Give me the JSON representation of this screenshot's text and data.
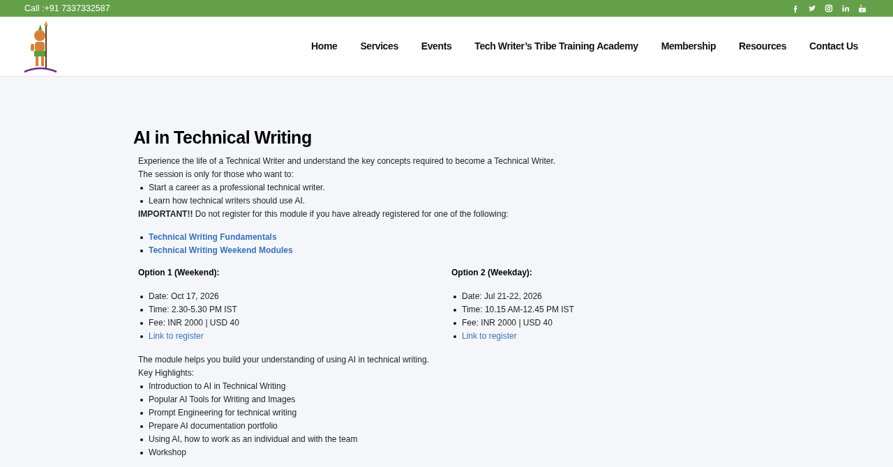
{
  "top_bar": {
    "phone": "Call :+91 7337332587"
  },
  "nav": {
    "items": [
      "Home",
      "Services",
      "Events",
      "Tech Writer’s Tribe Training Academy",
      "Membership",
      "Resources",
      "Contact Us"
    ]
  },
  "article": {
    "title": "AI in Technical Writing",
    "intro": "Experience the life of a Technical Writer and understand the key concepts required to become a Technical Writer.",
    "audience": "The session is only for those who want to:",
    "goals": [
      "Start a career as a professional technical writer.",
      "Learn how technical writers should use AI."
    ],
    "notice": "**IMPORTANT!!** Do not register for this module if you have already registered for one of the following:",
    "excluded_modules": [
      "Technical Writing Fundamentals",
      "Technical Writing Weekend Modules"
    ],
    "options": [
      {
        "heading": "Option 1 (Weekend):",
        "details": [
          "Date: Oct 17, 2026",
          "Time: 2.30-5.30 PM IST",
          "Fee: INR 2000 | USD 40"
        ],
        "link": "Link to register"
      },
      {
        "heading": "Option 2 (Weekday):",
        "details": [
          "Date: Jul 21-22, 2026",
          "Time: 10.15 AM-12.45 PM IST",
          "Fee: INR 2000 | USD 40"
        ],
        "link": "Link to register"
      }
    ],
    "summary": "The module helps you build your understanding of using AI in technical writing.",
    "highlights_label": "Key Highlights:",
    "highlights": [
      "Introduction to AI in Technical Writing",
      "Popular AI Tools for Writing and Images",
      "Prompt Engineering for technical writing",
      "Prepare AI documentation portfolio",
      "Using AI, how to work as an individual and with the team",
      "Workshop"
    ]
  }
}
